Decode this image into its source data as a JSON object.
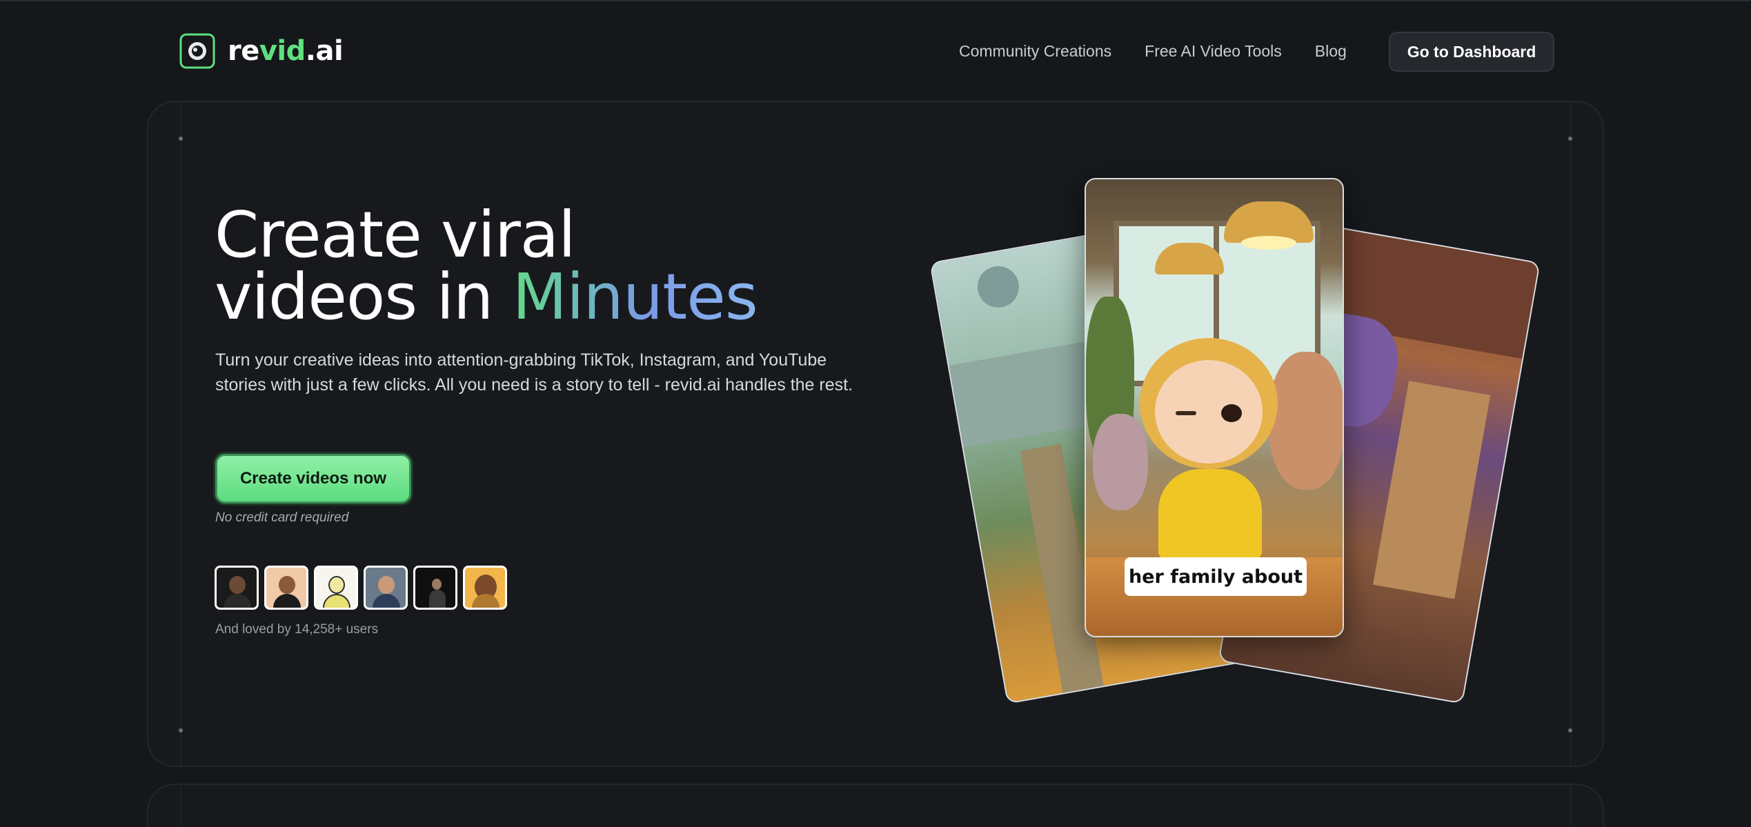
{
  "brand": {
    "logo_prefix": "re",
    "logo_highlight": "vid",
    "logo_suffix": ".ai",
    "accent": "#5ee07f"
  },
  "nav": {
    "links": [
      "Community Creations",
      "Free AI Video Tools",
      "Blog"
    ],
    "dashboard_label": "Go to Dashboard"
  },
  "hero": {
    "title_line1": "Create viral",
    "title_line2_prefix": "videos in ",
    "title_line2_highlight": "Minutes",
    "subtitle": "Turn your creative ideas into attention-grabbing TikTok, Instagram, and YouTube stories with just a few clicks. All you need is a story to tell - revid.ai handles the rest.",
    "cta_label": "Create videos now",
    "cta_note": "No credit card required",
    "loved_text": "And loved by 14,258+ users"
  },
  "preview": {
    "caption": "her family about"
  }
}
